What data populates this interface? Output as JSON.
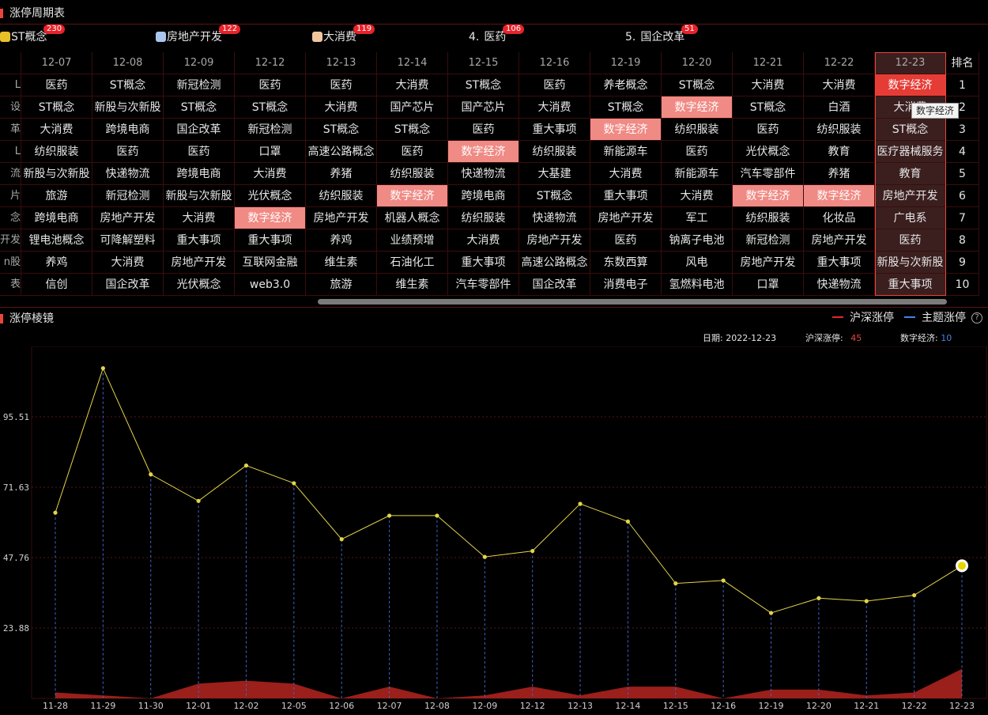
{
  "top_panel": {
    "title": "涨停周期表"
  },
  "leaders": [
    {
      "rank": "",
      "name": "ST概念",
      "badge": "230",
      "medal": "#e8c12a"
    },
    {
      "rank": "",
      "name": "房地产开发",
      "badge": "122",
      "medal": "#a9c7ee"
    },
    {
      "rank": "",
      "name": "大消费",
      "badge": "119",
      "medal": "#f2c79d"
    },
    {
      "rank": "4.",
      "name": "医药",
      "badge": "106",
      "medal": ""
    },
    {
      "rank": "5.",
      "name": "国企改革",
      "badge": "51",
      "medal": ""
    }
  ],
  "table": {
    "left_stub": [
      "",
      "L",
      "设",
      "革",
      "L",
      "流",
      "片",
      "念",
      "开发",
      "n股",
      "表"
    ],
    "dates": [
      "12-07",
      "12-08",
      "12-09",
      "12-12",
      "12-13",
      "12-14",
      "12-15",
      "12-16",
      "12-19",
      "12-20",
      "12-21",
      "12-22",
      "12-23"
    ],
    "rank_header": "排名",
    "ranks": [
      "1",
      "2",
      "3",
      "4",
      "5",
      "6",
      "7",
      "8",
      "9",
      "10"
    ],
    "rows": [
      [
        "医药",
        "ST概念",
        "新冠检测",
        "医药",
        "医药",
        "大消费",
        "ST概念",
        "医药",
        "养老概念",
        "ST概念",
        "大消费",
        "大消费",
        "数字经济"
      ],
      [
        "ST概念",
        "新股与次新股",
        "ST概念",
        "ST概念",
        "大消费",
        "国产芯片",
        "国产芯片",
        "大消费",
        "ST概念",
        "数字经济",
        "ST概念",
        "白酒",
        "大消费"
      ],
      [
        "大消费",
        "跨境电商",
        "国企改革",
        "新冠检测",
        "ST概念",
        "ST概念",
        "医药",
        "重大事项",
        "数字经济",
        "纺织服装",
        "医药",
        "纺织服装",
        "ST概念"
      ],
      [
        "纺织服装",
        "医药",
        "医药",
        "口罩",
        "高速公路概念",
        "医药",
        "数字经济",
        "纺织服装",
        "新能源车",
        "医药",
        "光伏概念",
        "教育",
        "医疗器械服务"
      ],
      [
        "新股与次新股",
        "快递物流",
        "跨境电商",
        "大消费",
        "养猪",
        "纺织服装",
        "快递物流",
        "大基建",
        "大消费",
        "新能源车",
        "汽车零部件",
        "养猪",
        "教育"
      ],
      [
        "旅游",
        "新冠检测",
        "新股与次新股",
        "光伏概念",
        "纺织服装",
        "数字经济",
        "跨境电商",
        "ST概念",
        "重大事项",
        "大消费",
        "数字经济",
        "数字经济",
        "房地产开发"
      ],
      [
        "跨境电商",
        "房地产开发",
        "大消费",
        "数字经济",
        "房地产开发",
        "机器人概念",
        "纺织服装",
        "快递物流",
        "房地产开发",
        "军工",
        "纺织服装",
        "化妆品",
        "广电系"
      ],
      [
        "锂电池概念",
        "可降解塑料",
        "重大事项",
        "重大事项",
        "养鸡",
        "业绩预增",
        "大消费",
        "房地产开发",
        "医药",
        "钠离子电池",
        "新冠检测",
        "房地产开发",
        "医药"
      ],
      [
        "养鸡",
        "大消费",
        "房地产开发",
        "互联网金融",
        "维生素",
        "石油化工",
        "重大事项",
        "高速公路概念",
        "东数西算",
        "风电",
        "房地产开发",
        "重大事项",
        "新股与次新股"
      ],
      [
        "信创",
        "国企改革",
        "光伏概念",
        "web3.0",
        "旅游",
        "维生素",
        "汽车零部件",
        "国企改革",
        "消费电子",
        "氢燃料电池",
        "口罩",
        "快递物流",
        "重大事项"
      ]
    ],
    "highlight_term": "数字经济",
    "selected_column": "12-23",
    "tooltip": "数字经济"
  },
  "bottom_panel": {
    "title": "涨停棱镜"
  },
  "legend": {
    "market_label": "沪深涨停",
    "theme_label": "主题涨停",
    "market_color": "#e8232b",
    "theme_color": "#4a7fe8"
  },
  "info": {
    "date_label": "日期:",
    "date_value": "2022-12-23",
    "market_label": "沪深涨停:",
    "market_value": "45",
    "theme_label": "数字经济:",
    "theme_value": "10"
  },
  "chart_data": {
    "type": "line",
    "x": [
      "11-28",
      "11-29",
      "11-30",
      "12-01",
      "12-02",
      "12-05",
      "12-06",
      "12-07",
      "12-08",
      "12-09",
      "12-12",
      "12-13",
      "12-14",
      "12-15",
      "12-16",
      "12-19",
      "12-20",
      "12-21",
      "12-22",
      "12-23"
    ],
    "series": [
      {
        "name": "沪深涨停",
        "values": [
          63,
          112,
          76,
          67,
          79,
          73,
          54,
          62,
          62,
          48,
          50,
          66,
          60,
          39,
          40,
          29,
          34,
          33,
          35,
          45
        ]
      },
      {
        "name": "主题涨停",
        "values": [
          2,
          1,
          0,
          5,
          6,
          5,
          0,
          4,
          0,
          1,
          4,
          1,
          4,
          4,
          0,
          3,
          3,
          1,
          2,
          10
        ]
      }
    ],
    "y_ticks": [
      "23.88",
      "47.76",
      "71.63",
      "95.51"
    ],
    "ylim": [
      0,
      119.4
    ],
    "grid": true
  }
}
